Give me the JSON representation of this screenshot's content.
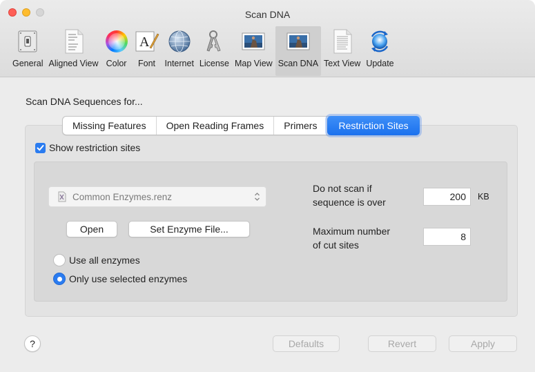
{
  "window": {
    "title": "Scan DNA"
  },
  "toolbar": {
    "items": [
      {
        "label": "General",
        "icon": "switch-icon"
      },
      {
        "label": "Aligned View",
        "icon": "aligned-document-icon"
      },
      {
        "label": "Color",
        "icon": "color-wheel-icon"
      },
      {
        "label": "Font",
        "icon": "font-icon"
      },
      {
        "label": "Internet",
        "icon": "globe-icon"
      },
      {
        "label": "License",
        "icon": "keys-icon"
      },
      {
        "label": "Map View",
        "icon": "map-view-icon"
      },
      {
        "label": "Scan DNA",
        "icon": "scan-dna-icon",
        "selected": true
      },
      {
        "label": "Text View",
        "icon": "text-document-icon"
      },
      {
        "label": "Update",
        "icon": "update-icon"
      }
    ]
  },
  "main": {
    "section_title": "Scan DNA Sequences for...",
    "tabs": [
      {
        "label": "Missing Features",
        "active": false
      },
      {
        "label": "Open Reading Frames",
        "active": false
      },
      {
        "label": "Primers",
        "active": false
      },
      {
        "label": "Restriction Sites",
        "active": true
      }
    ],
    "show_restriction_sites": {
      "label": "Show restriction sites",
      "checked": true
    },
    "enzyme_file": {
      "value": "Common Enzymes.renz",
      "icon": "enzyme-file-icon"
    },
    "buttons": {
      "open": "Open",
      "set_enzyme_file": "Set Enzyme File..."
    },
    "radios": [
      {
        "label": "Use all enzymes",
        "selected": false
      },
      {
        "label": "Only use selected enzymes",
        "selected": true
      }
    ],
    "scan_limit": {
      "label_line1": "Do not scan if",
      "label_line2": "sequence is over",
      "value": "200",
      "unit": "KB"
    },
    "max_cut_sites": {
      "label_line1": "Maximum number",
      "label_line2": "of cut sites",
      "value": "8"
    }
  },
  "footer": {
    "help": "?",
    "defaults": "Defaults",
    "revert": "Revert",
    "apply": "Apply"
  },
  "colors": {
    "accent": "#2b7cf0",
    "window_bg": "#ececec",
    "toolbar_selected": "#cfcfcf"
  }
}
